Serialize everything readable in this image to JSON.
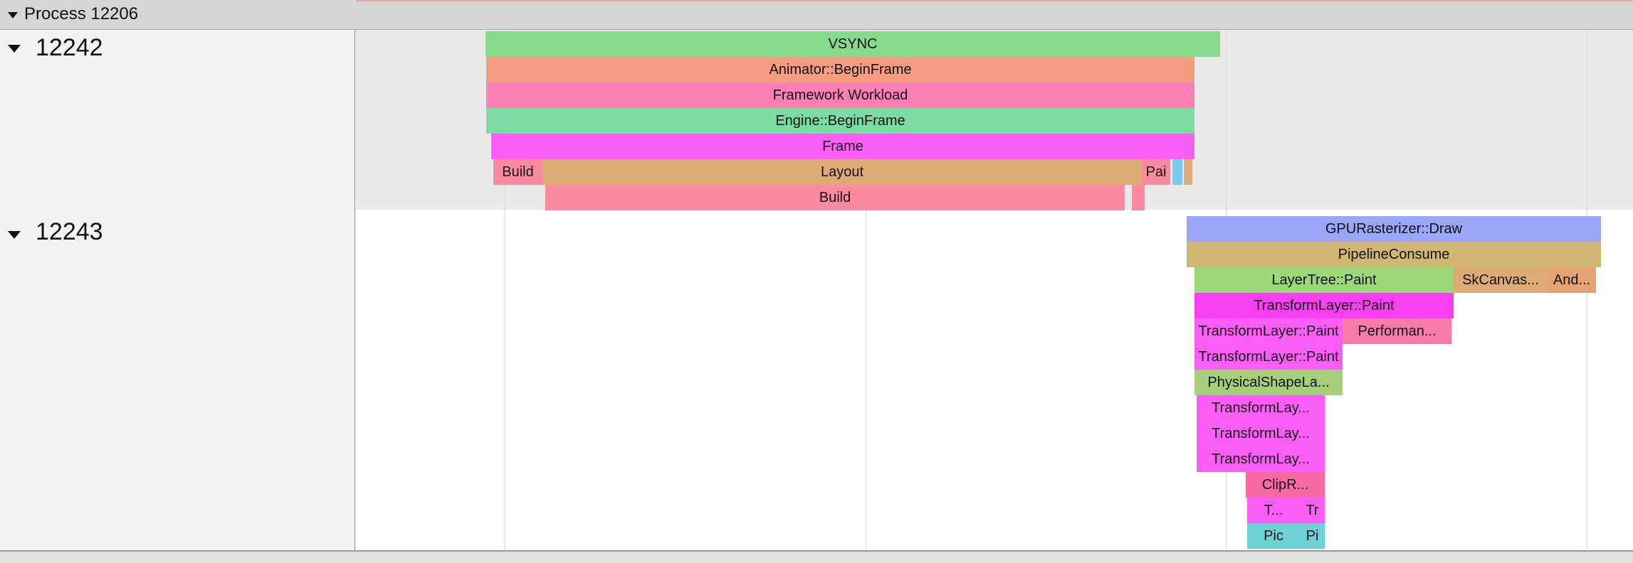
{
  "process": {
    "title": "Process 12206"
  },
  "threads": [
    {
      "id": "12242"
    },
    {
      "id": "12243"
    }
  ],
  "colors": {
    "header_bg": "#d6d6d6",
    "labels_bg": "#f2f2f2",
    "thread1_lane_bg": "#e9e9e9",
    "thread2_lane_bg": "#ffffff",
    "gridline": "#dcdcdc"
  },
  "slices_12242": [
    {
      "label": "VSYNC",
      "color": "#86d98d"
    },
    {
      "label": "Animator::BeginFrame",
      "color": "#f59d80"
    },
    {
      "label": "Framework Workload",
      "color": "#fb7fb5"
    },
    {
      "label": "Engine::BeginFrame",
      "color": "#7adca0"
    },
    {
      "label": "Frame",
      "color": "#fb5ef6"
    },
    {
      "label": "Build",
      "color": "#fb8aa1"
    },
    {
      "label": "Layout",
      "color": "#dcaa74"
    },
    {
      "label": "Pai",
      "color": "#fb8aa1"
    },
    {
      "label": "Build",
      "color": "#fb8aa1"
    }
  ],
  "slices_12243": [
    {
      "label": "GPURasterizer::Draw",
      "color": "#9aa6f7"
    },
    {
      "label": "PipelineConsume",
      "color": "#d0b874"
    },
    {
      "label": "LayerTree::Paint",
      "color": "#9cd878"
    },
    {
      "label": "SkCanvas...",
      "color": "#dcaa74"
    },
    {
      "label": "And...",
      "color": "#e5a374"
    },
    {
      "label": "TransformLayer::Paint",
      "color": "#f53ff0"
    },
    {
      "label": "TransformLayer::Paint",
      "color": "#fb5ef6"
    },
    {
      "label": "Performan...",
      "color": "#f77ba8"
    },
    {
      "label": "TransformLayer::Paint",
      "color": "#fb5ef6"
    },
    {
      "label": "PhysicalShapeLa...",
      "color": "#a6cf7c"
    },
    {
      "label": "TransformLay...",
      "color": "#fb5ef6"
    },
    {
      "label": "TransformLay...",
      "color": "#fb5ef6"
    },
    {
      "label": "TransformLay...",
      "color": "#fb5ef6"
    },
    {
      "label": "ClipR...",
      "color": "#f76aa3"
    },
    {
      "label": "T...",
      "color": "#fb5ef6"
    },
    {
      "label": "Tr",
      "color": "#fb5ef6"
    },
    {
      "label": "Pic",
      "color": "#6fd3d6"
    },
    {
      "label": "Pi",
      "color": "#6fd3d6"
    }
  ]
}
